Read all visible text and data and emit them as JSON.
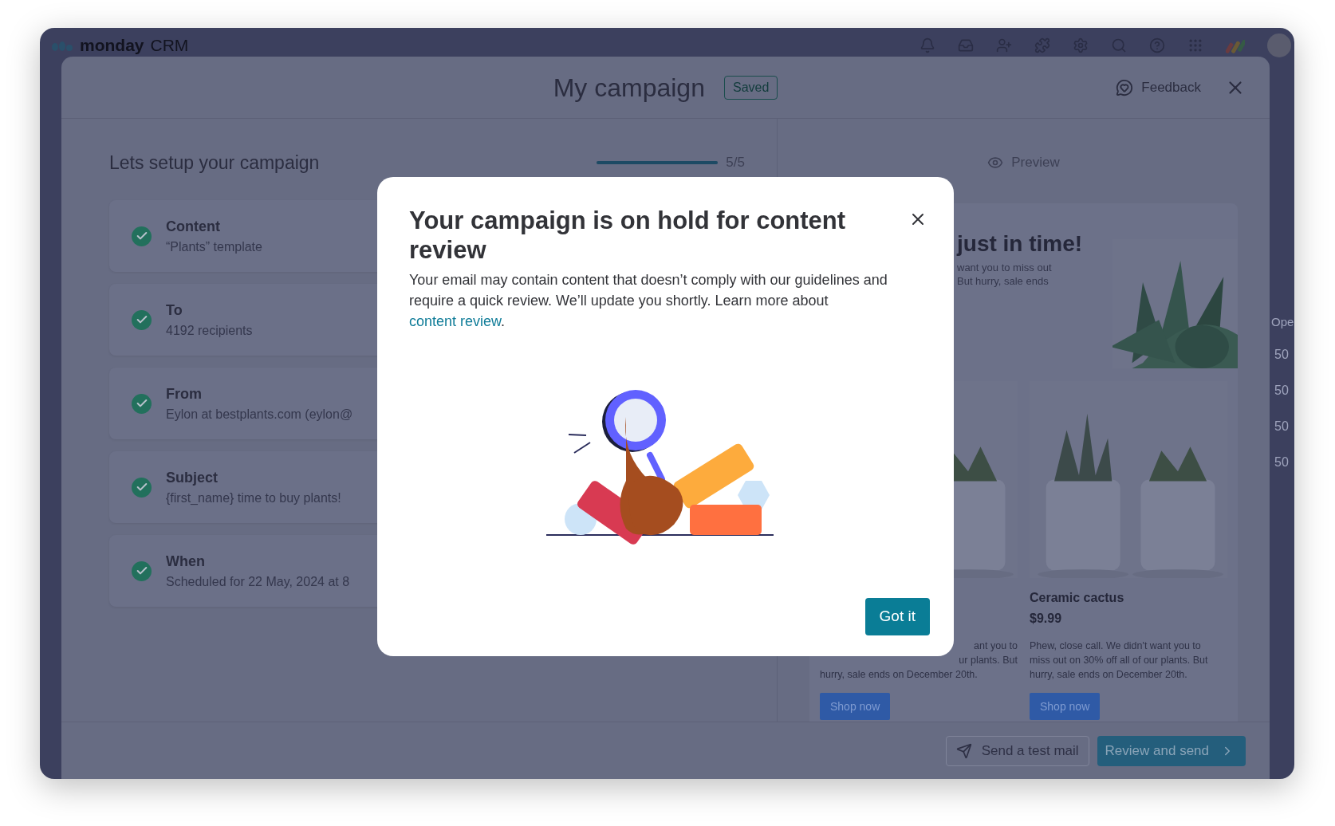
{
  "app_header": {
    "logo": "monday",
    "product": "CRM"
  },
  "campaign": {
    "title": "My campaign",
    "status_badge": "Saved",
    "feedback": "Feedback"
  },
  "setup": {
    "heading": "Lets setup your campaign",
    "progress": {
      "level": 1,
      "reading": "5/5"
    },
    "steps": [
      {
        "label": "Content",
        "detail": "“Plants” template",
        "done": true
      },
      {
        "label": "To",
        "detail": "4192 recipients",
        "done": true
      },
      {
        "label": "From",
        "detail": "Eylon at bestplants.com (eylon@",
        "done": true
      },
      {
        "label": "Subject",
        "detail": "{first_name} time to buy plants!",
        "done": true
      },
      {
        "label": "When",
        "detail": "Scheduled for 22 May, 2024 at 8",
        "done": true
      }
    ]
  },
  "preview": {
    "label": "Preview",
    "hero_title": "just in time!",
    "hero_lines": [
      "want you to miss out",
      "But hurry, sale ends"
    ],
    "products": [
      {
        "cut_lines": [
          "ant you to",
          "ur plants. But"
        ],
        "lines": [
          "hurry, sale ends on December 20th."
        ],
        "button": "Shop now"
      },
      {
        "name": "Ceramic cactus",
        "price": "$9.99",
        "lines": [
          "Phew, close call. We didn't want you to",
          "miss out on 30% off all of our plants. But",
          "hurry, sale ends on December 20th."
        ],
        "button": "Shop now"
      }
    ]
  },
  "background_table": {
    "column_header": "Ope",
    "cells": [
      "50",
      "50",
      "50",
      "50"
    ]
  },
  "footer": {
    "buttons": [
      {
        "kind": "outline",
        "label": "Send a test mail"
      },
      {
        "kind": "primary",
        "label": "Review and send"
      }
    ]
  },
  "dialog": {
    "title": "Your campaign is on hold for content review",
    "body": "Your email may contain content that doesn’t comply with our guidelines and require a quick review. We’ll update you shortly. Learn more about ",
    "link": "content review",
    "body_end": ".",
    "button": "Got it"
  }
}
